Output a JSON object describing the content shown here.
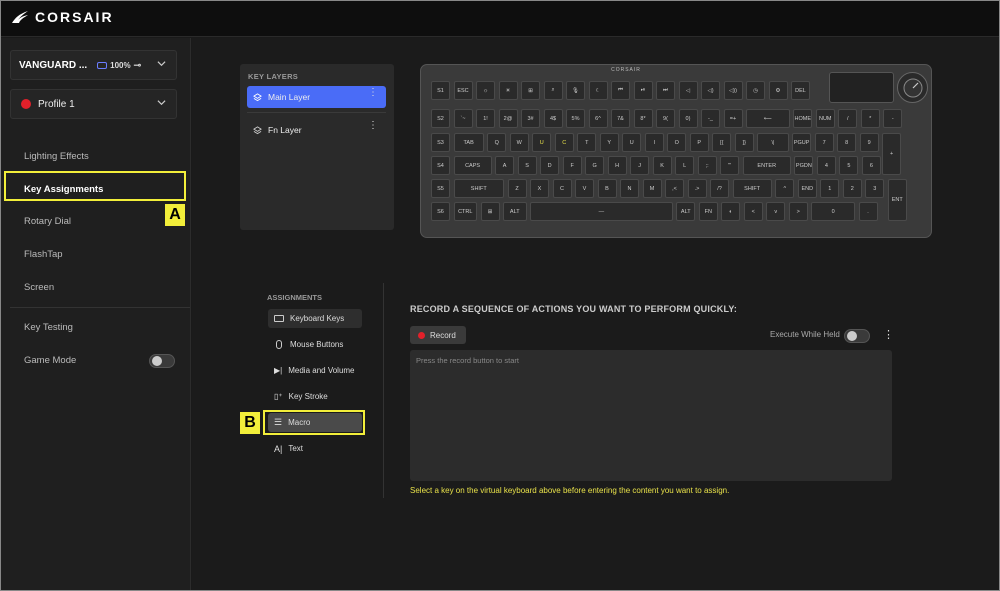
{
  "app": {
    "brand": "CORSAIR"
  },
  "sidebar": {
    "device": {
      "name": "VANGUARD ...",
      "battery": "100%"
    },
    "profile": {
      "name": "Profile 1",
      "color": "#e2202a"
    },
    "nav": [
      {
        "label": "Lighting Effects"
      },
      {
        "label": "Key Assignments"
      },
      {
        "label": "Rotary Dial"
      },
      {
        "label": "FlashTap"
      },
      {
        "label": "Screen"
      },
      {
        "label": "Key Testing"
      },
      {
        "label": "Game Mode"
      }
    ],
    "game_mode_enabled": false
  },
  "annotations": {
    "a": "A",
    "b": "B",
    "highlight_color": "#f2ee3a"
  },
  "key_layers": {
    "title": "KEY LAYERS",
    "layers": [
      {
        "label": "Main Layer",
        "selected": true
      },
      {
        "label": "Fn Layer",
        "selected": false
      }
    ],
    "accent": "#4a6cf7"
  },
  "keyboard": {
    "brand": "CORSAIR",
    "rows": [
      [
        "S1",
        "ESC",
        "☼",
        "☀",
        "⊞",
        "⌕",
        "🎙",
        "☾",
        "⏮",
        "⏯",
        "⏭",
        "◁",
        "◁)",
        "◁))",
        "◷",
        "⚙",
        "DEL"
      ],
      [
        "S2",
        "`~",
        "1!",
        "2@",
        "3#",
        "4$",
        "5%",
        "6^",
        "7&",
        "8*",
        "9(",
        "0)",
        "-_",
        "=+",
        "⟵",
        "HOME",
        "NUM",
        "/",
        "*",
        "-"
      ],
      [
        "S3",
        "TAB",
        "Q",
        "W",
        "U",
        "C",
        "T",
        "Y",
        "U",
        "I",
        "O",
        "P",
        "[{",
        "]}",
        "\\|",
        "PGUP",
        "7",
        "8",
        "9",
        "+"
      ],
      [
        "S4",
        "CAPS",
        "A",
        "S",
        "D",
        "F",
        "G",
        "H",
        "J",
        "K",
        "L",
        ";:",
        "'\"",
        "ENTER",
        "PGDN",
        "4",
        "5",
        "6"
      ],
      [
        "S5",
        "SHIFT",
        "Z",
        "X",
        "C",
        "V",
        "B",
        "N",
        "M",
        ",<",
        ".>",
        "/?",
        "SHIFT",
        "^",
        "END",
        "1",
        "2",
        "3",
        "ENT"
      ],
      [
        "S6",
        "CTRL",
        "⊞",
        "ALT",
        "—",
        "ALT",
        "FN",
        "◐",
        "<",
        "v",
        ">",
        "0",
        "."
      ]
    ]
  },
  "assignments": {
    "title": "ASSIGNMENTS",
    "items": [
      {
        "label": "Keyboard Keys",
        "icon": "keyboard-icon"
      },
      {
        "label": "Mouse Buttons",
        "icon": "mouse-icon"
      },
      {
        "label": "Media and Volume",
        "icon": "media-icon"
      },
      {
        "label": "Key Stroke",
        "icon": "keystroke-icon"
      },
      {
        "label": "Macro",
        "icon": "list-icon",
        "selected": true
      },
      {
        "label": "Text",
        "icon": "text-icon"
      }
    ]
  },
  "macro": {
    "title": "RECORD A SEQUENCE OF ACTIONS YOU WANT TO PERFORM QUICKLY:",
    "record_label": "Record",
    "execute_label": "Execute While Held",
    "execute_enabled": false,
    "placeholder": "Press the record button to start",
    "hint": "Select a key on the virtual keyboard above before entering the content you want to assign."
  }
}
